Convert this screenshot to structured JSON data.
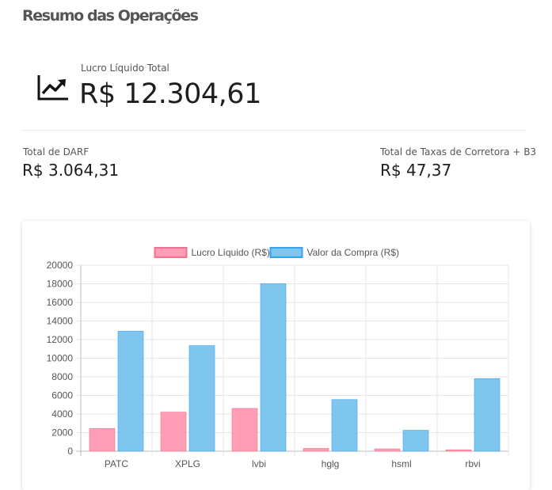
{
  "header": {
    "title": "Resumo das Operações"
  },
  "summary": {
    "net_profit_label": "Lucro Líquido Total",
    "net_profit_value": "R$ 12.304,61",
    "darf_label": "Total de DARF",
    "darf_value": "R$ 3.064,31",
    "fees_label": "Total de Taxas de Corretora + B3",
    "fees_value": "R$ 47,37",
    "icon": "trending-up-icon"
  },
  "chart_data": {
    "type": "bar",
    "categories": [
      "PATC",
      "XPLG",
      "lvbi",
      "hglg",
      "hsml",
      "rbvi"
    ],
    "series": [
      {
        "name": "Lucro Líquido (R$)",
        "values": [
          2450,
          4200,
          4600,
          300,
          250,
          150
        ],
        "color": "#ff9eb6",
        "border": "#f0728f"
      },
      {
        "name": "Valor da Compra (R$)",
        "values": [
          12900,
          11350,
          18000,
          5550,
          2250,
          7800
        ],
        "color": "#7fc6ee",
        "border": "#36a2eb"
      }
    ],
    "yticks": [
      "0",
      "2000",
      "4000",
      "6000",
      "8000",
      "10000",
      "12000",
      "14000",
      "16000",
      "18000",
      "20000"
    ],
    "ylim": [
      0,
      20000
    ],
    "grid": true,
    "legend": "top-center"
  }
}
